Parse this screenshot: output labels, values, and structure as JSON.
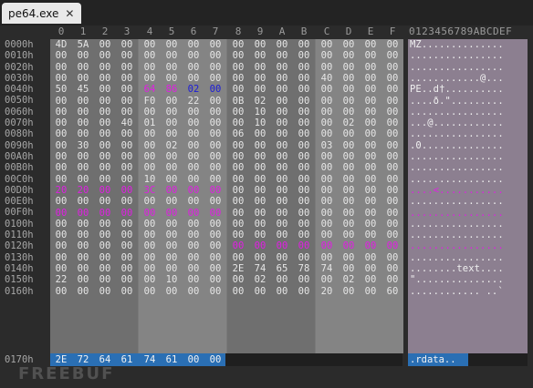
{
  "tab": {
    "title": "pe64.exe",
    "close_icon": "close-icon"
  },
  "columns": [
    "0",
    "1",
    "2",
    "3",
    "4",
    "5",
    "6",
    "7",
    "8",
    "9",
    "A",
    "B",
    "C",
    "D",
    "E",
    "F"
  ],
  "ascii_header": "0123456789ABCDEF",
  "rows": [
    {
      "offset": "0000h",
      "hex": [
        "4D",
        "5A",
        "00",
        "00",
        "00",
        "00",
        "00",
        "00",
        "00",
        "00",
        "00",
        "00",
        "00",
        "00",
        "00",
        "00"
      ],
      "ascii": "MZ.............."
    },
    {
      "offset": "0010h",
      "hex": [
        "00",
        "00",
        "00",
        "00",
        "00",
        "00",
        "00",
        "00",
        "00",
        "00",
        "00",
        "00",
        "00",
        "00",
        "00",
        "00"
      ],
      "ascii": "................"
    },
    {
      "offset": "0020h",
      "hex": [
        "00",
        "00",
        "00",
        "00",
        "00",
        "00",
        "00",
        "00",
        "00",
        "00",
        "00",
        "00",
        "00",
        "00",
        "00",
        "00"
      ],
      "ascii": "................"
    },
    {
      "offset": "0030h",
      "hex": [
        "00",
        "00",
        "00",
        "00",
        "00",
        "00",
        "00",
        "00",
        "00",
        "00",
        "00",
        "00",
        "40",
        "00",
        "00",
        "00"
      ],
      "ascii": "............@..."
    },
    {
      "offset": "0040h",
      "hex": [
        "50",
        "45",
        "00",
        "00",
        "64",
        "86",
        "02",
        "00",
        "00",
        "00",
        "00",
        "00",
        "00",
        "00",
        "00",
        "00"
      ],
      "ascii": "PE..d†.........."
    },
    {
      "offset": "0050h",
      "hex": [
        "00",
        "00",
        "00",
        "00",
        "F0",
        "00",
        "22",
        "00",
        "0B",
        "02",
        "00",
        "00",
        "00",
        "00",
        "00",
        "00"
      ],
      "ascii": "....ð.\"........."
    },
    {
      "offset": "0060h",
      "hex": [
        "00",
        "00",
        "00",
        "00",
        "00",
        "00",
        "00",
        "00",
        "00",
        "10",
        "00",
        "00",
        "00",
        "00",
        "00",
        "00"
      ],
      "ascii": "................"
    },
    {
      "offset": "0070h",
      "hex": [
        "00",
        "00",
        "00",
        "40",
        "01",
        "00",
        "00",
        "00",
        "00",
        "10",
        "00",
        "00",
        "00",
        "02",
        "00",
        "00"
      ],
      "ascii": "...@............"
    },
    {
      "offset": "0080h",
      "hex": [
        "00",
        "00",
        "00",
        "00",
        "00",
        "00",
        "00",
        "00",
        "06",
        "00",
        "00",
        "00",
        "00",
        "00",
        "00",
        "00"
      ],
      "ascii": "................"
    },
    {
      "offset": "0090h",
      "hex": [
        "00",
        "30",
        "00",
        "00",
        "00",
        "02",
        "00",
        "00",
        "00",
        "00",
        "00",
        "00",
        "03",
        "00",
        "00",
        "00"
      ],
      "ascii": ".0.............."
    },
    {
      "offset": "00A0h",
      "hex": [
        "00",
        "00",
        "00",
        "00",
        "00",
        "00",
        "00",
        "00",
        "00",
        "00",
        "00",
        "00",
        "00",
        "00",
        "00",
        "00"
      ],
      "ascii": "................"
    },
    {
      "offset": "00B0h",
      "hex": [
        "00",
        "00",
        "00",
        "00",
        "00",
        "00",
        "00",
        "00",
        "00",
        "00",
        "00",
        "00",
        "00",
        "00",
        "00",
        "00"
      ],
      "ascii": "................"
    },
    {
      "offset": "00C0h",
      "hex": [
        "00",
        "00",
        "00",
        "00",
        "10",
        "00",
        "00",
        "00",
        "00",
        "00",
        "00",
        "00",
        "00",
        "00",
        "00",
        "00"
      ],
      "ascii": "................"
    },
    {
      "offset": "00D0h",
      "hex": [
        "20",
        "20",
        "00",
        "00",
        "3C",
        "00",
        "00",
        "00",
        "00",
        "00",
        "00",
        "00",
        "00",
        "00",
        "00",
        "00"
      ],
      "ascii": "....<..........."
    },
    {
      "offset": "00E0h",
      "hex": [
        "00",
        "00",
        "00",
        "00",
        "00",
        "00",
        "00",
        "00",
        "00",
        "00",
        "00",
        "00",
        "00",
        "00",
        "00",
        "00"
      ],
      "ascii": "................"
    },
    {
      "offset": "00F0h",
      "hex": [
        "00",
        "00",
        "00",
        "00",
        "00",
        "00",
        "00",
        "00",
        "00",
        "00",
        "00",
        "00",
        "00",
        "00",
        "00",
        "00"
      ],
      "ascii": "................"
    },
    {
      "offset": "0100h",
      "hex": [
        "00",
        "00",
        "00",
        "00",
        "00",
        "00",
        "00",
        "00",
        "00",
        "00",
        "00",
        "00",
        "00",
        "00",
        "00",
        "00"
      ],
      "ascii": "................"
    },
    {
      "offset": "0110h",
      "hex": [
        "00",
        "00",
        "00",
        "00",
        "00",
        "00",
        "00",
        "00",
        "00",
        "00",
        "00",
        "00",
        "00",
        "00",
        "00",
        "00"
      ],
      "ascii": "................"
    },
    {
      "offset": "0120h",
      "hex": [
        "00",
        "00",
        "00",
        "00",
        "00",
        "00",
        "00",
        "00",
        "00",
        "00",
        "00",
        "00",
        "00",
        "00",
        "00",
        "00"
      ],
      "ascii": "................"
    },
    {
      "offset": "0130h",
      "hex": [
        "00",
        "00",
        "00",
        "00",
        "00",
        "00",
        "00",
        "00",
        "00",
        "00",
        "00",
        "00",
        "00",
        "00",
        "00",
        "00"
      ],
      "ascii": "................"
    },
    {
      "offset": "0140h",
      "hex": [
        "00",
        "00",
        "00",
        "00",
        "00",
        "00",
        "00",
        "00",
        "2E",
        "74",
        "65",
        "78",
        "74",
        "00",
        "00",
        "00"
      ],
      "ascii": "........text...."
    },
    {
      "offset": "0150h",
      "hex": [
        "22",
        "00",
        "00",
        "00",
        "00",
        "10",
        "00",
        "00",
        "00",
        "02",
        "00",
        "00",
        "00",
        "02",
        "00",
        "00"
      ],
      "ascii": "\"..............."
    },
    {
      "offset": "0160h",
      "hex": [
        "00",
        "00",
        "00",
        "00",
        "00",
        "00",
        "00",
        "00",
        "00",
        "00",
        "00",
        "00",
        "20",
        "00",
        "00",
        "60"
      ],
      "ascii": "............ ..`"
    }
  ],
  "last_row": {
    "offset": "0170h",
    "hex": [
      "2E",
      "72",
      "64",
      "61",
      "74",
      "61",
      "00",
      "00"
    ],
    "ascii": ".rdata.."
  },
  "watermark": "FREEBUF"
}
